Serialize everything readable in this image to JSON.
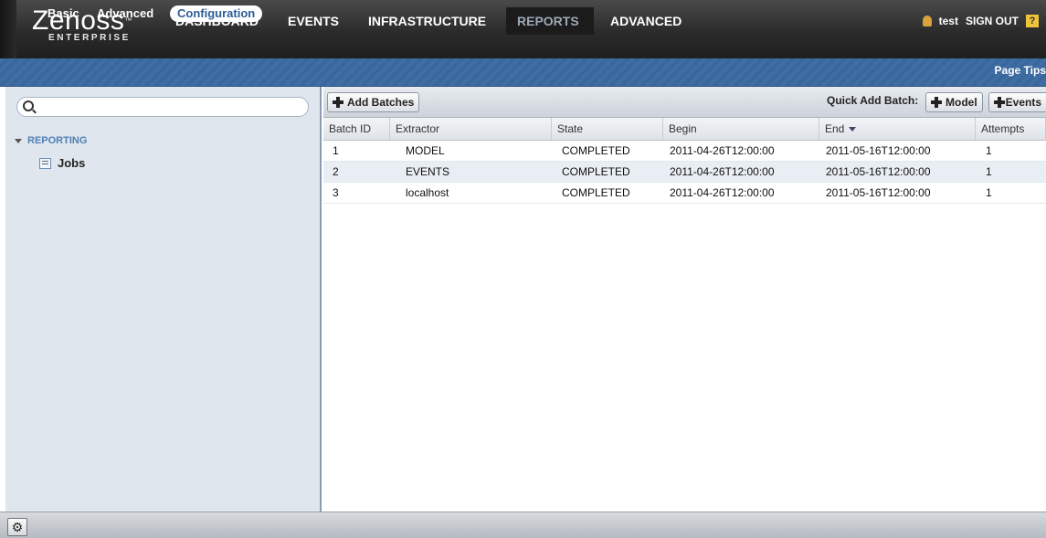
{
  "brand": {
    "name": "Zenoss",
    "tm": "™",
    "edition": "ENTERPRISE"
  },
  "nav": {
    "items": [
      "DASHBOARD",
      "EVENTS",
      "INFRASTRUCTURE",
      "REPORTS",
      "ADVANCED"
    ],
    "active": "REPORTS"
  },
  "user": {
    "name": "test",
    "signout": "SIGN OUT",
    "help": "?"
  },
  "subnav": {
    "items": [
      "Basic",
      "Advanced",
      "Configuration"
    ],
    "active": "Configuration",
    "page_tips": "Page Tips"
  },
  "tree": {
    "root": "REPORTING",
    "child": "Jobs"
  },
  "search": {
    "placeholder": "",
    "value": ""
  },
  "toolbar": {
    "add_batches": "Add Batches",
    "quick_add_label": "Quick Add Batch:",
    "quick_model": "Model",
    "quick_events": "Events"
  },
  "table": {
    "columns": [
      "Batch ID",
      "Extractor",
      "State",
      "Begin",
      "End",
      "Attempts"
    ],
    "sorted_column": "End",
    "rows": [
      [
        "1",
        "MODEL",
        "COMPLETED",
        "2011-04-26T12:00:00",
        "2011-05-16T12:00:00",
        "1"
      ],
      [
        "2",
        "EVENTS",
        "COMPLETED",
        "2011-04-26T12:00:00",
        "2011-05-16T12:00:00",
        "1"
      ],
      [
        "3",
        "localhost",
        "COMPLETED",
        "2011-04-26T12:00:00",
        "2011-05-16T12:00:00",
        "1"
      ]
    ]
  },
  "footer": {
    "gear_icon": "gear-icon"
  }
}
